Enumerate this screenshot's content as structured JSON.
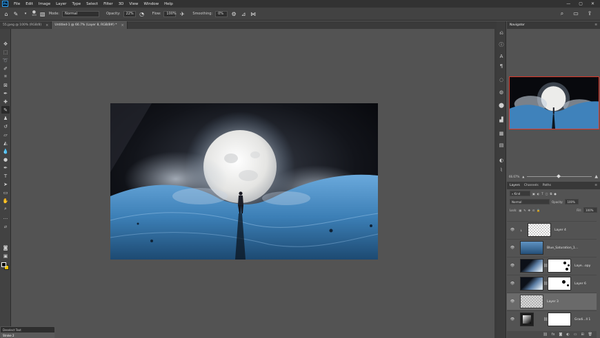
{
  "menu": {
    "logo": "Ps",
    "items": [
      "File",
      "Edit",
      "Image",
      "Layer",
      "Type",
      "Select",
      "Filter",
      "3D",
      "View",
      "Window",
      "Help"
    ]
  },
  "options": {
    "brush_size": "100",
    "mode_label": "Mode:",
    "mode_value": "Normal",
    "opacity_label": "Opacity:",
    "opacity_value": "22%",
    "flow_label": "Flow:",
    "flow_value": "100%",
    "smoothing_label": "Smoothing:",
    "smoothing_value": "0%"
  },
  "tabs": [
    {
      "label": "55.jpeg @ 100% (RGB/8)",
      "close": "×"
    },
    {
      "label": "Untitled-1 @ 66.7% (Layer 8, RGB/8#) *",
      "close": "×"
    }
  ],
  "navigator": {
    "tab": "Navigator",
    "zoom": "66.67%"
  },
  "layers_panel": {
    "tabs": [
      "Layers",
      "Channels",
      "Paths"
    ],
    "filter": "Kind",
    "blend": "Normal",
    "opacity_label": "Opacity:",
    "opacity_value": "100%",
    "lock_label": "Lock:",
    "fill_label": "Fill:",
    "fill_value": "100%",
    "layers": [
      {
        "name": "Layer 4"
      },
      {
        "name": "Blue_Saturation_1..."
      },
      {
        "name": "Laye...opy"
      },
      {
        "name": "Layer 6"
      },
      {
        "name": "Layer 3"
      },
      {
        "name": "Gradi...ll 1"
      }
    ]
  },
  "mini_panel": {
    "rows": [
      "Deselect Text",
      "Stroke 2"
    ]
  },
  "colors": {
    "foreground": "#000000",
    "background": "#f5c400",
    "accent_selection": "#e0392a"
  }
}
